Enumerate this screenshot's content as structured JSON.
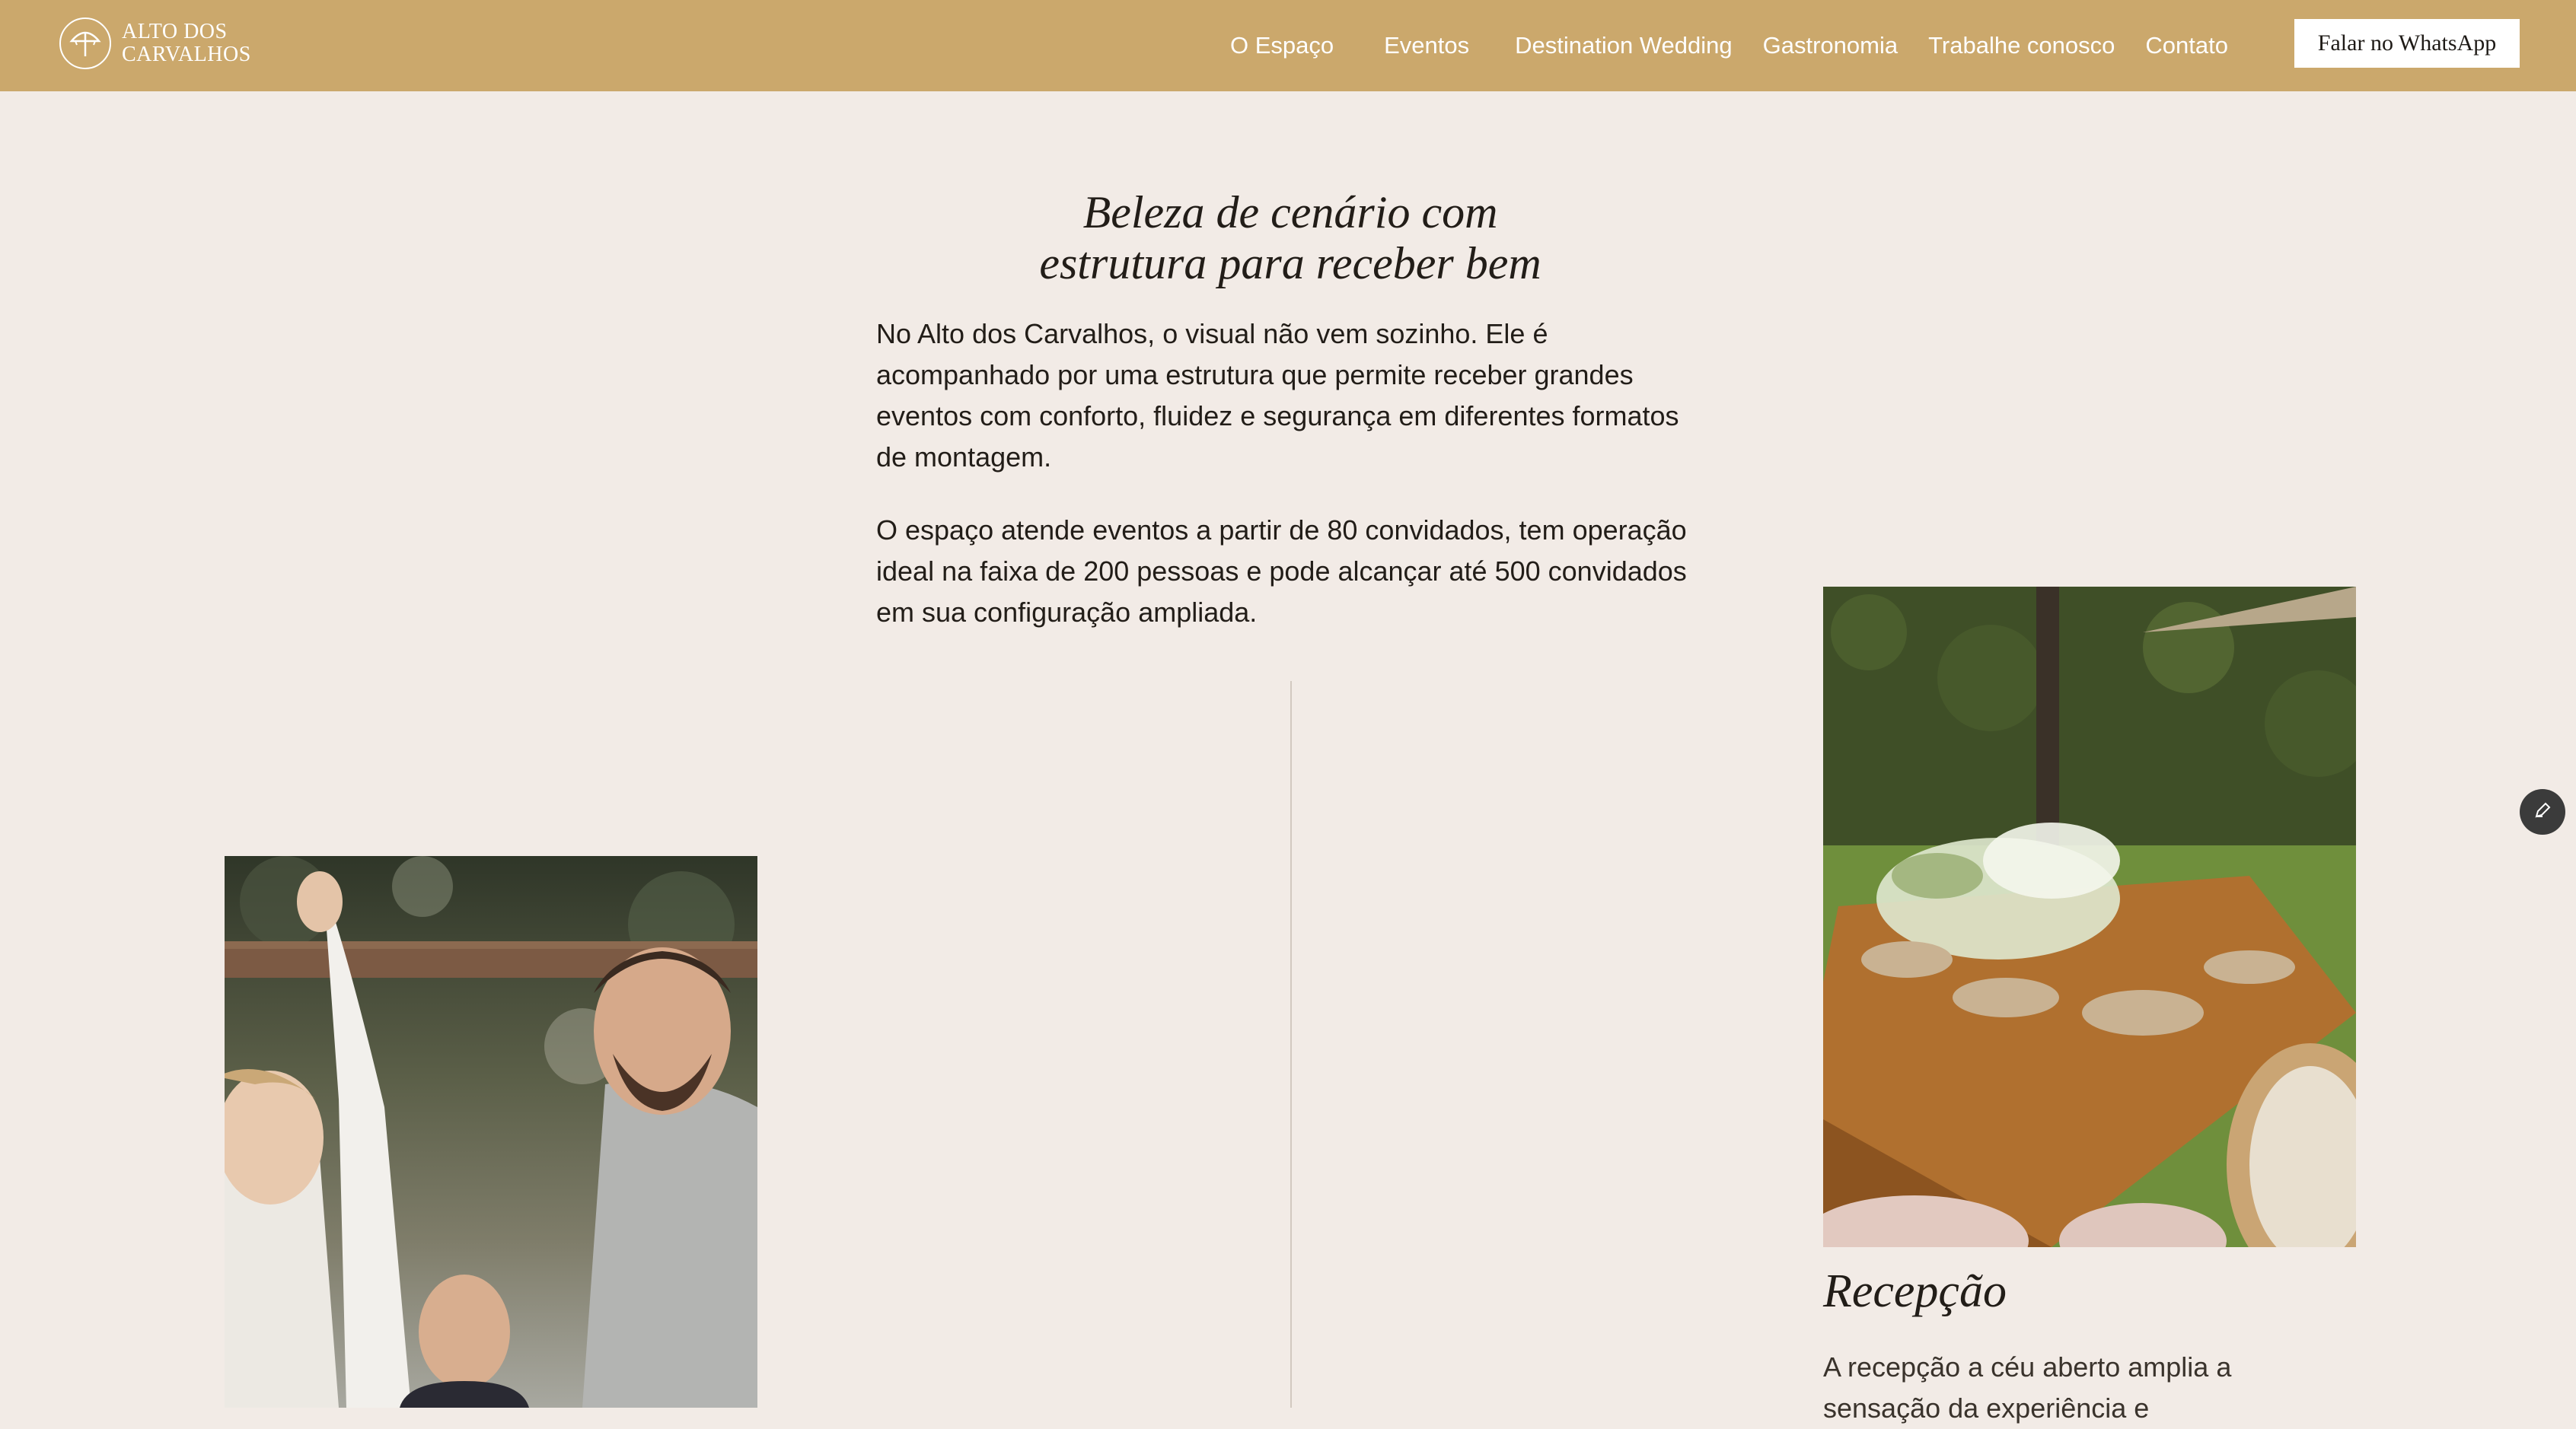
{
  "header": {
    "brand_line1": "ALTO DOS",
    "brand_line2": "CARVALHOS",
    "logo_icon": "tree-umbrella-icon",
    "nav": [
      {
        "label": "O Espaço"
      },
      {
        "label": "Eventos"
      },
      {
        "label": "Destination Wedding"
      },
      {
        "label": "Gastronomia"
      },
      {
        "label": "Trabalhe conosco"
      },
      {
        "label": "Contato"
      }
    ],
    "cta_label": "Falar no WhatsApp",
    "bg_color": "#cba86c"
  },
  "main": {
    "title_line1": "Beleza de cenário com",
    "title_line2": "estrutura para receber bem",
    "paragraph1": "No Alto dos Carvalhos, o visual não vem sozinho. Ele é acompanhado por uma estrutura que permite receber grandes eventos com conforto, fluidez e segurança em diferentes formatos de montagem.",
    "paragraph2": "O espaço atende eventos a partir de 80 convidados, tem operação ideal na faixa de 200 pessoas e pode alcançar até 500 convidados em sua configuração ampliada."
  },
  "cards": [
    {
      "title": "Recepção",
      "text": "A recepção a céu aberto amplia a sensação da experiência e"
    }
  ],
  "floating": {
    "edit_icon": "pencil-icon"
  }
}
